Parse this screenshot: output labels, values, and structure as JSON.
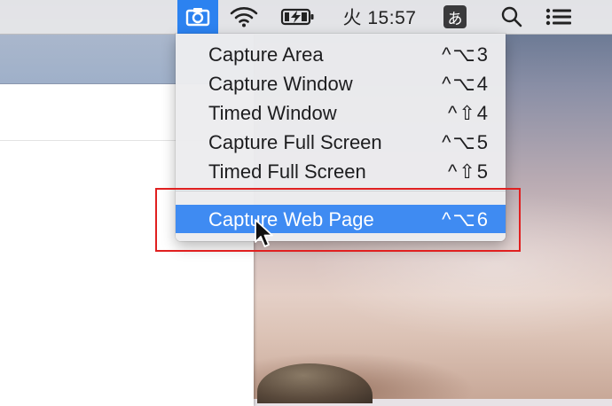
{
  "menubar": {
    "clock": "火 15:57",
    "input_method": "あ"
  },
  "capture_menu": {
    "items": [
      {
        "label": "Capture Area",
        "shortcut": "^⌥3"
      },
      {
        "label": "Capture Window",
        "shortcut": "^⌥4"
      },
      {
        "label": "Timed Window",
        "shortcut": "^⇧4"
      },
      {
        "label": "Capture Full Screen",
        "shortcut": "^⌥5"
      },
      {
        "label": "Timed Full Screen",
        "shortcut": "^⇧5"
      },
      {
        "label": "Capture Web Page",
        "shortcut": "^⌥6",
        "highlighted": true
      }
    ]
  },
  "colors": {
    "highlight": "#3f8bf2",
    "annotation_border": "#e02020",
    "active_menubar_icon": "#2c82f0"
  },
  "icons": [
    "camera-icon",
    "wifi-icon",
    "battery-charging-icon",
    "search-icon",
    "list-icon",
    "cursor-icon"
  ]
}
